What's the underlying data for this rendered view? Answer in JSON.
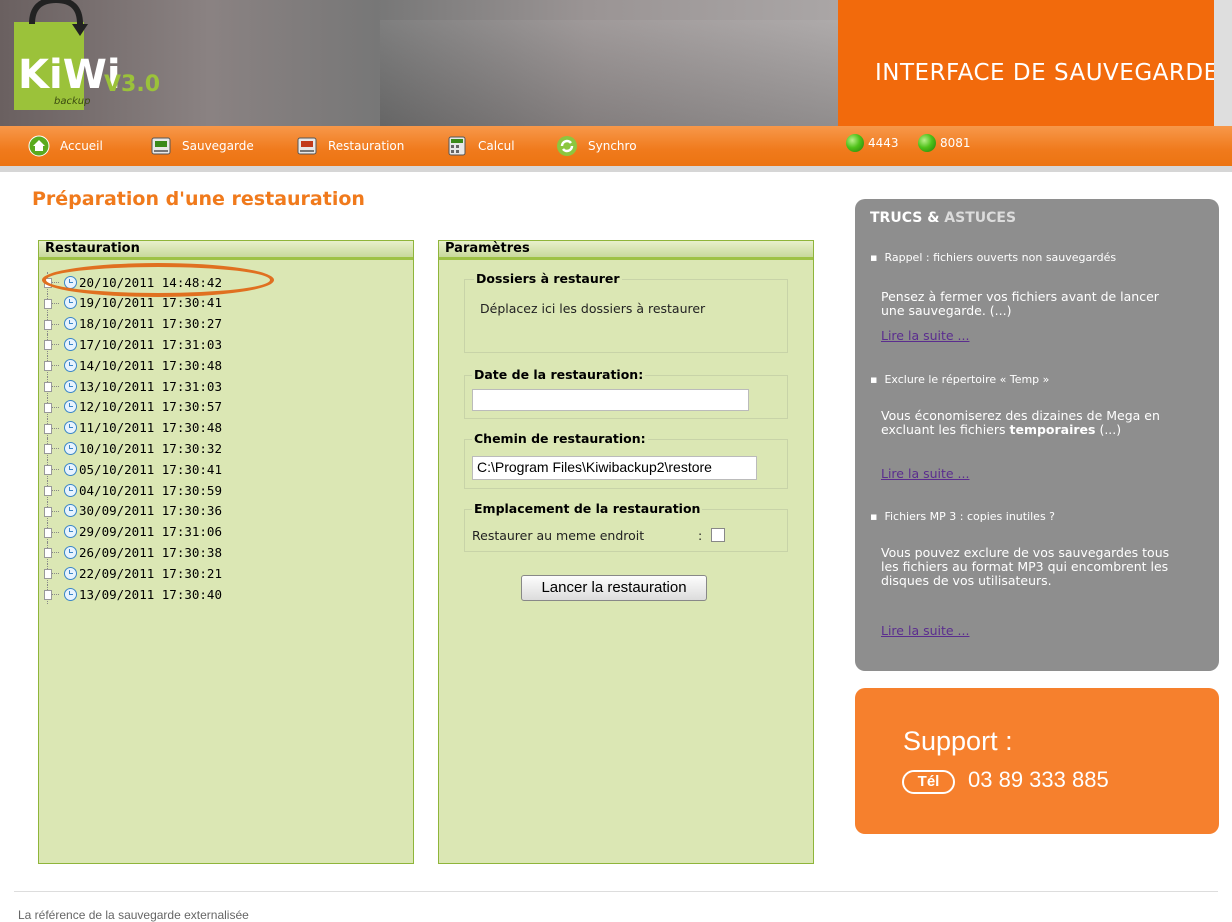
{
  "header": {
    "logo_text": "KiWi",
    "logo_sub": "backup",
    "version": "V3.0",
    "title": "INTERFACE DE SAUVEGARDE",
    "brand_color": "#f26a0c",
    "logo_color": "#9bc23a"
  },
  "nav": {
    "items": [
      {
        "label": "Accueil",
        "icon": "home-icon"
      },
      {
        "label": "Sauvegarde",
        "icon": "backup-icon"
      },
      {
        "label": "Restauration",
        "icon": "restore-icon"
      },
      {
        "label": "Calcul",
        "icon": "calculator-icon"
      },
      {
        "label": "Synchro",
        "icon": "sync-icon"
      }
    ],
    "servers": [
      {
        "label": "4443",
        "status_color": "#4fc21a"
      },
      {
        "label": "8081",
        "status_color": "#4fc21a"
      }
    ]
  },
  "page": {
    "title": "Préparation d'une restauration"
  },
  "restauration": {
    "title": "Restauration",
    "items": [
      "20/10/2011 14:48:42",
      "19/10/2011 17:30:41",
      "18/10/2011 17:30:27",
      "17/10/2011 17:31:03",
      "14/10/2011 17:30:48",
      "13/10/2011 17:31:03",
      "12/10/2011 17:30:57",
      "11/10/2011 17:30:48",
      "10/10/2011 17:30:32",
      "05/10/2011 17:30:41",
      "04/10/2011 17:30:59",
      "30/09/2011 17:30:36",
      "29/09/2011 17:31:06",
      "26/09/2011 17:30:38",
      "22/09/2011 17:30:21",
      "13/09/2011 17:30:40"
    ],
    "highlight_color": "#e07020"
  },
  "parametres": {
    "title": "Paramètres",
    "dossiers": {
      "legend": "Dossiers à restaurer",
      "hint": "Déplacez ici les dossiers à restaurer"
    },
    "date": {
      "legend": "Date de la restauration:",
      "value": ""
    },
    "chemin": {
      "legend": "Chemin de restauration:",
      "value": "C:\\Program Files\\Kiwibackup2\\restore"
    },
    "emplacement": {
      "legend": "Emplacement de la restauration",
      "label": "Restaurer au meme endroit",
      "colon": ":",
      "checked": false
    },
    "button_label": "Lancer la restauration"
  },
  "tips": {
    "title_a": "TRUCS & ",
    "title_b": "ASTUCES",
    "items": [
      {
        "head": "Rappel : fichiers ouverts non sauvegardés",
        "body": "Pensez à fermer vos fichiers avant de lancer une sauvegarde. (...)",
        "link": "Lire la suite ..."
      },
      {
        "head": "Exclure le répertoire « Temp »",
        "body_a": "Vous économiserez des dizaines de Mega en excluant les fichiers ",
        "body_bold": "temporaires",
        "body_b": " (...)",
        "link": "Lire la suite ..."
      },
      {
        "head": "Fichiers MP 3 : copies inutiles ?",
        "body": "Vous pouvez exclure de vos sauvegardes tous les fichiers au format MP3 qui encombrent les disques de vos utilisateurs.",
        "link": "Lire la suite ..."
      }
    ]
  },
  "support": {
    "label": "Support :",
    "tel_badge": "Tél",
    "phone": "03 89 333 885"
  },
  "footer": {
    "text": "La référence de la sauvegarde externalisée"
  }
}
